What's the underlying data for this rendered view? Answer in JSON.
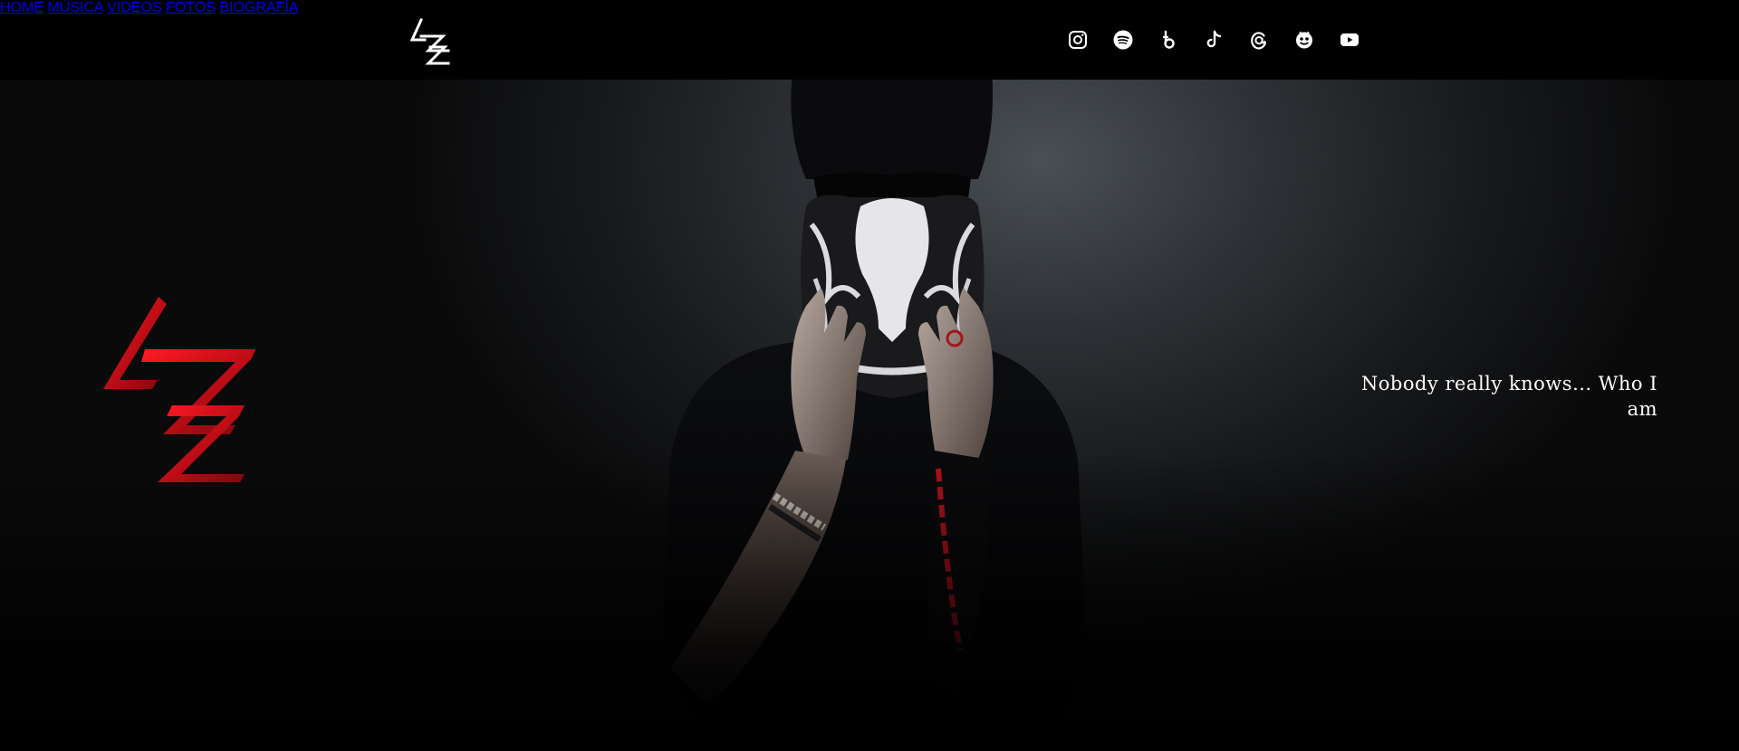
{
  "nav": {
    "logo": "LZ",
    "items": [
      {
        "label": "HOME"
      },
      {
        "label": "MÚSICA"
      },
      {
        "label": "VIDEOS"
      },
      {
        "label": "FOTOS"
      },
      {
        "label": "BIOGRAFÍA"
      }
    ],
    "social_icons": [
      "instagram-icon",
      "spotify-icon",
      "tidal-icon",
      "tiktok-icon",
      "threads-icon",
      "bandcamp-icon",
      "youtube-icon"
    ]
  },
  "hero": {
    "logo": "LZ",
    "tagline": "Nobody really knows... Who I am",
    "accent_color": "#d10f1a"
  }
}
